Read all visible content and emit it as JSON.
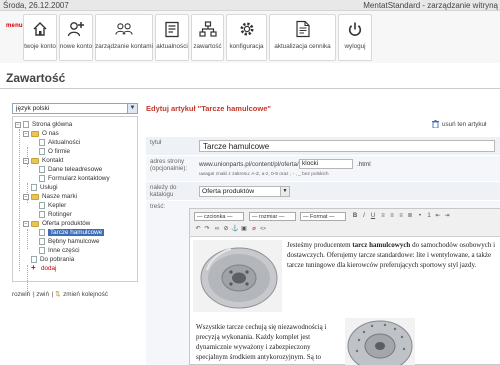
{
  "header": {
    "date": "Środa, 26.12.2007",
    "app_title": "MentatStandard - zarządzanie witryną"
  },
  "menu_label": "menu",
  "toolbar": [
    {
      "label": "twoje konto",
      "icon": "home-icon"
    },
    {
      "label": "nowe konto",
      "icon": "add-user-icon"
    },
    {
      "label": "zarządzanie kontami",
      "icon": "users-icon"
    },
    {
      "label": "aktualności",
      "icon": "news-icon"
    },
    {
      "label": "zawartość",
      "icon": "sitemap-icon"
    },
    {
      "label": "konfiguracja",
      "icon": "gear-icon"
    },
    {
      "label": "aktualizacja cennika",
      "icon": "pricelist-icon"
    },
    {
      "label": "wyloguj",
      "icon": "power-icon"
    }
  ],
  "page_title": "Zawartość",
  "sidebar": {
    "language": "język polski",
    "tree": [
      {
        "label": "Strona główna",
        "type": "page",
        "level": 0
      },
      {
        "label": "O nas",
        "type": "folder",
        "level": 1
      },
      {
        "label": "Aktualności",
        "type": "page",
        "level": 2
      },
      {
        "label": "O firmie",
        "type": "page",
        "level": 2
      },
      {
        "label": "Kontakt",
        "type": "folder",
        "level": 1
      },
      {
        "label": "Dane teleadresowe",
        "type": "page",
        "level": 2
      },
      {
        "label": "Formularz kontaktowy",
        "type": "page",
        "level": 2
      },
      {
        "label": "Usługi",
        "type": "page",
        "level": 1
      },
      {
        "label": "Nasze marki",
        "type": "folder",
        "level": 1
      },
      {
        "label": "Kepler",
        "type": "page",
        "level": 2
      },
      {
        "label": "Rotinger",
        "type": "page",
        "level": 2
      },
      {
        "label": "Oferta produktów",
        "type": "folder",
        "level": 1
      },
      {
        "label": "Tarcze hamulcowe",
        "type": "page",
        "level": 2,
        "selected": true
      },
      {
        "label": "Bębny hamulcowe",
        "type": "page",
        "level": 2
      },
      {
        "label": "Inne części",
        "type": "page",
        "level": 2
      },
      {
        "label": "Do pobrania",
        "type": "page",
        "level": 1
      },
      {
        "label": "dodaj",
        "type": "add",
        "level": 1
      }
    ],
    "actions": {
      "expand": "rozwiń",
      "collapse": "zwiń",
      "reorder": "zmień kolejność"
    }
  },
  "editor": {
    "heading": "Edytuj artykuł \"Tarcze hamulcowe\"",
    "delete_label": "usuń ten artykuł",
    "title_label": "tytuł",
    "title_value": "Tarcze hamulcowe",
    "url_label": "adres strony (opcjonalnie):",
    "url_prefix": "www.unionparts.pl/content/pl/oferta/",
    "url_value": "klocki",
    "url_suffix": ".html",
    "url_note": "uwaga! znaki z zakresu: A-Z, a-z, 0-9 oraz , - , _ bez polskich",
    "category_label": "należy do katalogu",
    "category_value": "Oferta produktów",
    "content_label": "treść:",
    "rte": {
      "style_select": "— czcionka —",
      "size_select": "— rozmiar —",
      "format_select": "— Format —",
      "para1_pre": "Jesteśmy producentem ",
      "para1_bold": "tarcz hamulcowych",
      "para1_post": " do samochodów osobowych i dostawczych. Oferujemy tarcze standardowe: lite i wentylowane, a także tarcze tuningowe dla kierowców preferujących sportowy styl jazdy.",
      "para2": "Wszystkie tarcze cechują się niezawodnością i precyzją wykonania. Każdy komplet jest dynamicznie wyważony i zabezpieczony specjalnym środkiem antykorozyjnym. Są to"
    }
  }
}
